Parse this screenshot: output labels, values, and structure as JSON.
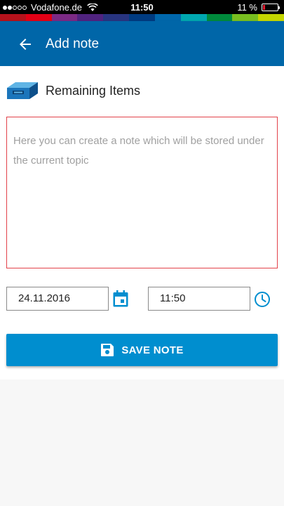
{
  "status_bar": {
    "carrier": "Vodafone.de",
    "time": "11:50",
    "battery": "11 %"
  },
  "colors": {
    "header": "#0066a8",
    "accent": "#008ecf",
    "error_border": "#e2424a",
    "rainbow": [
      "#b5121b",
      "#e20015",
      "#7b2a84",
      "#50237f",
      "#28347f",
      "#003b80",
      "#0067ac",
      "#00a8b0",
      "#008a3c",
      "#78be20",
      "#c4d600"
    ]
  },
  "header": {
    "title": "Add note",
    "back_icon": "arrow-back-icon"
  },
  "topic": {
    "icon": "drawer-icon",
    "label": "Remaining Items"
  },
  "note": {
    "placeholder": "Here you can create a note which will be stored under the current topic",
    "value": ""
  },
  "date": {
    "value": "24.11.2016",
    "icon": "calendar-icon"
  },
  "time": {
    "value": "11:50",
    "icon": "clock-icon"
  },
  "save": {
    "label": "SAVE NOTE",
    "icon": "floppy-disk-icon"
  }
}
